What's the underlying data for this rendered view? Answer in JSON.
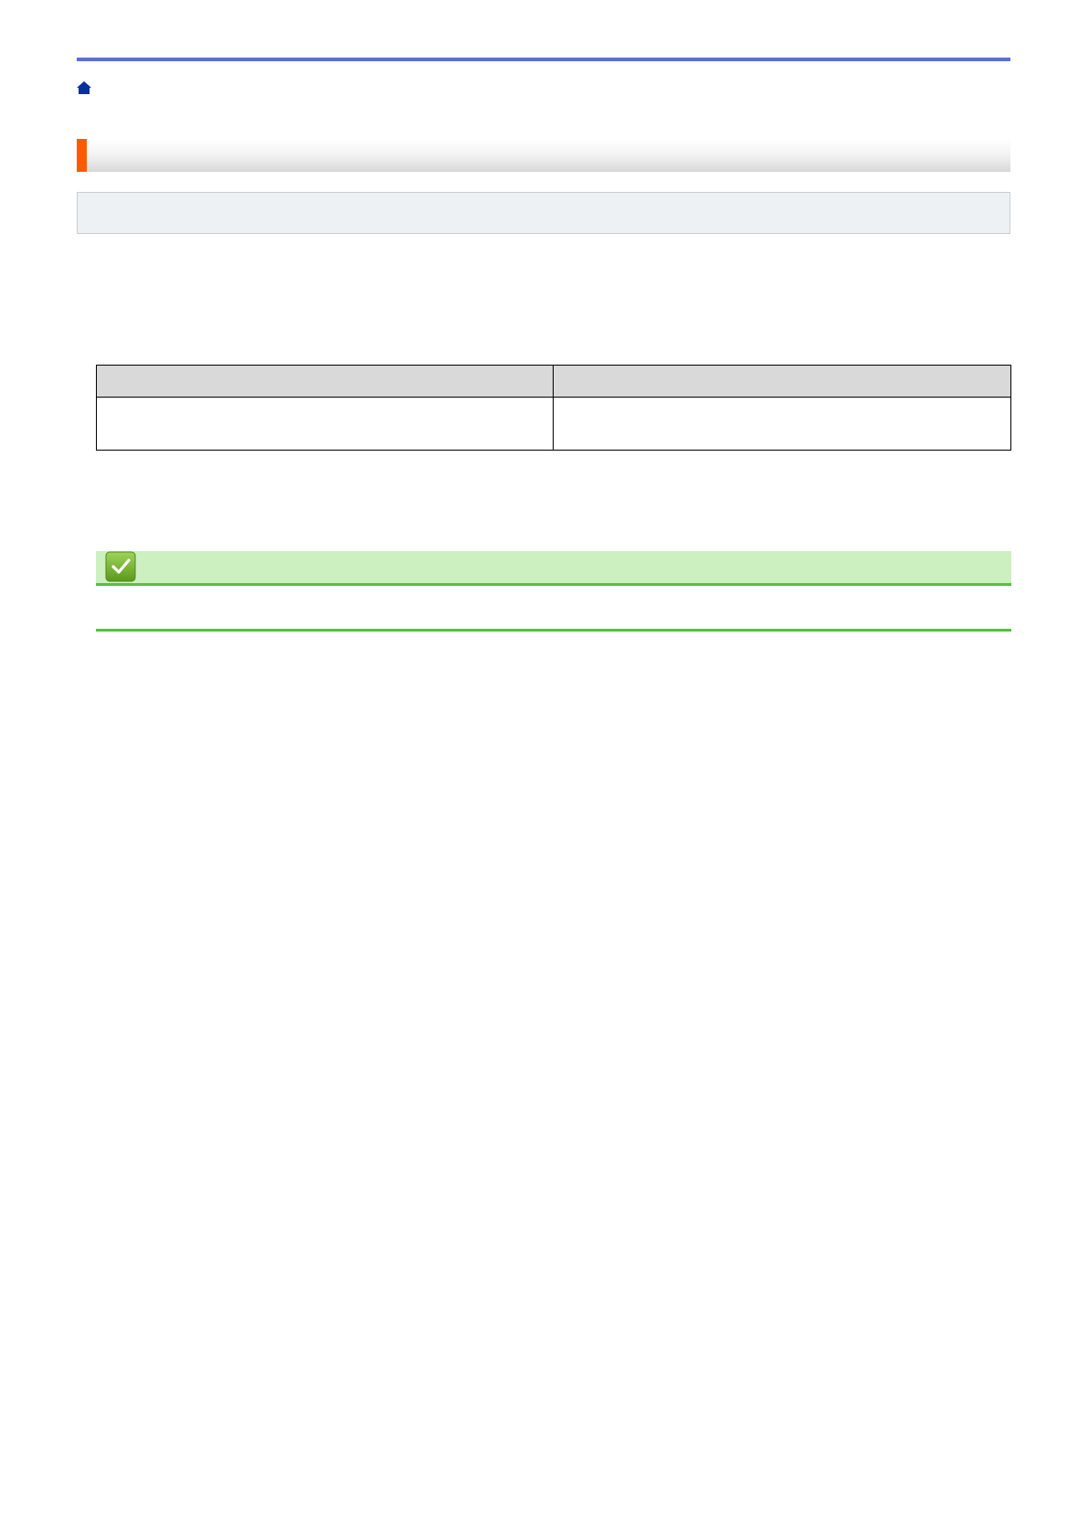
{
  "header": {
    "rule_color": "#5a6fd6",
    "home_icon": "home-icon",
    "breadcrumb_text": ""
  },
  "section": {
    "title": "",
    "accent_color": "#ff5a00"
  },
  "related_box": {
    "text": ""
  },
  "table": {
    "headers": [
      "",
      ""
    ],
    "rows": [
      [
        "",
        ""
      ]
    ]
  },
  "note": {
    "icon": "check-icon",
    "title": "",
    "bar_color": "#cdf0c0",
    "line_color": "#56c13b"
  },
  "footer": {
    "page_number": ""
  }
}
